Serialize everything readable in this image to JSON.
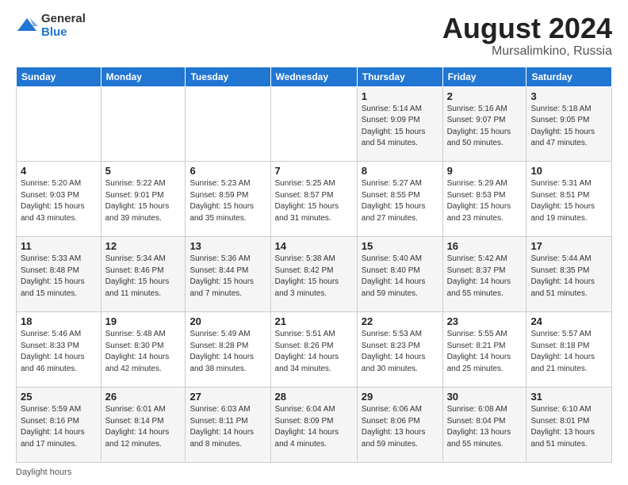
{
  "logo": {
    "general": "General",
    "blue": "Blue"
  },
  "title": "August 2024",
  "location": "Mursalimkino, Russia",
  "days_header": [
    "Sunday",
    "Monday",
    "Tuesday",
    "Wednesday",
    "Thursday",
    "Friday",
    "Saturday"
  ],
  "footer": "Daylight hours",
  "weeks": [
    [
      {
        "day": "",
        "info": ""
      },
      {
        "day": "",
        "info": ""
      },
      {
        "day": "",
        "info": ""
      },
      {
        "day": "",
        "info": ""
      },
      {
        "day": "1",
        "info": "Sunrise: 5:14 AM\nSunset: 9:09 PM\nDaylight: 15 hours\nand 54 minutes."
      },
      {
        "day": "2",
        "info": "Sunrise: 5:16 AM\nSunset: 9:07 PM\nDaylight: 15 hours\nand 50 minutes."
      },
      {
        "day": "3",
        "info": "Sunrise: 5:18 AM\nSunset: 9:05 PM\nDaylight: 15 hours\nand 47 minutes."
      }
    ],
    [
      {
        "day": "4",
        "info": "Sunrise: 5:20 AM\nSunset: 9:03 PM\nDaylight: 15 hours\nand 43 minutes."
      },
      {
        "day": "5",
        "info": "Sunrise: 5:22 AM\nSunset: 9:01 PM\nDaylight: 15 hours\nand 39 minutes."
      },
      {
        "day": "6",
        "info": "Sunrise: 5:23 AM\nSunset: 8:59 PM\nDaylight: 15 hours\nand 35 minutes."
      },
      {
        "day": "7",
        "info": "Sunrise: 5:25 AM\nSunset: 8:57 PM\nDaylight: 15 hours\nand 31 minutes."
      },
      {
        "day": "8",
        "info": "Sunrise: 5:27 AM\nSunset: 8:55 PM\nDaylight: 15 hours\nand 27 minutes."
      },
      {
        "day": "9",
        "info": "Sunrise: 5:29 AM\nSunset: 8:53 PM\nDaylight: 15 hours\nand 23 minutes."
      },
      {
        "day": "10",
        "info": "Sunrise: 5:31 AM\nSunset: 8:51 PM\nDaylight: 15 hours\nand 19 minutes."
      }
    ],
    [
      {
        "day": "11",
        "info": "Sunrise: 5:33 AM\nSunset: 8:48 PM\nDaylight: 15 hours\nand 15 minutes."
      },
      {
        "day": "12",
        "info": "Sunrise: 5:34 AM\nSunset: 8:46 PM\nDaylight: 15 hours\nand 11 minutes."
      },
      {
        "day": "13",
        "info": "Sunrise: 5:36 AM\nSunset: 8:44 PM\nDaylight: 15 hours\nand 7 minutes."
      },
      {
        "day": "14",
        "info": "Sunrise: 5:38 AM\nSunset: 8:42 PM\nDaylight: 15 hours\nand 3 minutes."
      },
      {
        "day": "15",
        "info": "Sunrise: 5:40 AM\nSunset: 8:40 PM\nDaylight: 14 hours\nand 59 minutes."
      },
      {
        "day": "16",
        "info": "Sunrise: 5:42 AM\nSunset: 8:37 PM\nDaylight: 14 hours\nand 55 minutes."
      },
      {
        "day": "17",
        "info": "Sunrise: 5:44 AM\nSunset: 8:35 PM\nDaylight: 14 hours\nand 51 minutes."
      }
    ],
    [
      {
        "day": "18",
        "info": "Sunrise: 5:46 AM\nSunset: 8:33 PM\nDaylight: 14 hours\nand 46 minutes."
      },
      {
        "day": "19",
        "info": "Sunrise: 5:48 AM\nSunset: 8:30 PM\nDaylight: 14 hours\nand 42 minutes."
      },
      {
        "day": "20",
        "info": "Sunrise: 5:49 AM\nSunset: 8:28 PM\nDaylight: 14 hours\nand 38 minutes."
      },
      {
        "day": "21",
        "info": "Sunrise: 5:51 AM\nSunset: 8:26 PM\nDaylight: 14 hours\nand 34 minutes."
      },
      {
        "day": "22",
        "info": "Sunrise: 5:53 AM\nSunset: 8:23 PM\nDaylight: 14 hours\nand 30 minutes."
      },
      {
        "day": "23",
        "info": "Sunrise: 5:55 AM\nSunset: 8:21 PM\nDaylight: 14 hours\nand 25 minutes."
      },
      {
        "day": "24",
        "info": "Sunrise: 5:57 AM\nSunset: 8:18 PM\nDaylight: 14 hours\nand 21 minutes."
      }
    ],
    [
      {
        "day": "25",
        "info": "Sunrise: 5:59 AM\nSunset: 8:16 PM\nDaylight: 14 hours\nand 17 minutes."
      },
      {
        "day": "26",
        "info": "Sunrise: 6:01 AM\nSunset: 8:14 PM\nDaylight: 14 hours\nand 12 minutes."
      },
      {
        "day": "27",
        "info": "Sunrise: 6:03 AM\nSunset: 8:11 PM\nDaylight: 14 hours\nand 8 minutes."
      },
      {
        "day": "28",
        "info": "Sunrise: 6:04 AM\nSunset: 8:09 PM\nDaylight: 14 hours\nand 4 minutes."
      },
      {
        "day": "29",
        "info": "Sunrise: 6:06 AM\nSunset: 8:06 PM\nDaylight: 13 hours\nand 59 minutes."
      },
      {
        "day": "30",
        "info": "Sunrise: 6:08 AM\nSunset: 8:04 PM\nDaylight: 13 hours\nand 55 minutes."
      },
      {
        "day": "31",
        "info": "Sunrise: 6:10 AM\nSunset: 8:01 PM\nDaylight: 13 hours\nand 51 minutes."
      }
    ]
  ]
}
